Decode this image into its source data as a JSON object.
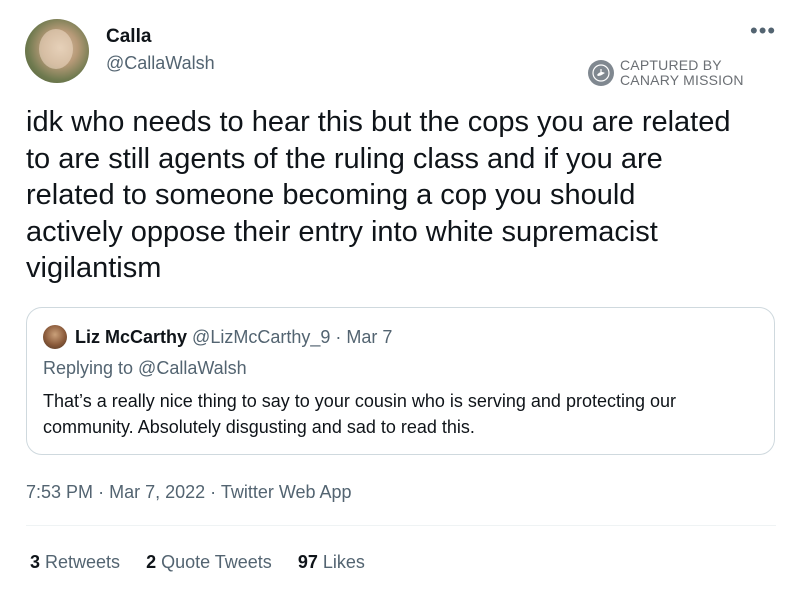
{
  "author": {
    "display_name": "Calla",
    "handle": "@CallaWalsh"
  },
  "watermark": {
    "line1": "CAPTURED BY",
    "line2": "CANARY MISSION",
    "icon": "canary-bird-icon"
  },
  "tweet_lines": [
    "idk who needs to hear this but the cops you are related",
    "to are still agents of the ruling class and if you are",
    "related to someone becoming a cop you should",
    "actively oppose their entry into white supremacist",
    "vigilantism"
  ],
  "quote": {
    "name": "Liz McCarthy",
    "handle": "@LizMcCarthy_9",
    "separator": "·",
    "date": "Mar 7",
    "replying_to": "Replying to @CallaWalsh",
    "text_lines": [
      "That’s a really nice thing to say to your cousin who is serving and protecting our",
      "community. Absolutely disgusting and sad to read this."
    ]
  },
  "meta": {
    "time": "7:53 PM",
    "separator": "·",
    "date": "Mar 7, 2022",
    "app": "Twitter Web App"
  },
  "stats": {
    "retweets_count": "3",
    "retweets_label": "Retweets",
    "quotes_count": "2",
    "quotes_label": "Quote Tweets",
    "likes_count": "97",
    "likes_label": "Likes"
  },
  "icons": {
    "more": "more-options-icon"
  },
  "colors": {
    "text": "#0f1419",
    "secondary": "#536471",
    "border": "#cfd9de"
  }
}
